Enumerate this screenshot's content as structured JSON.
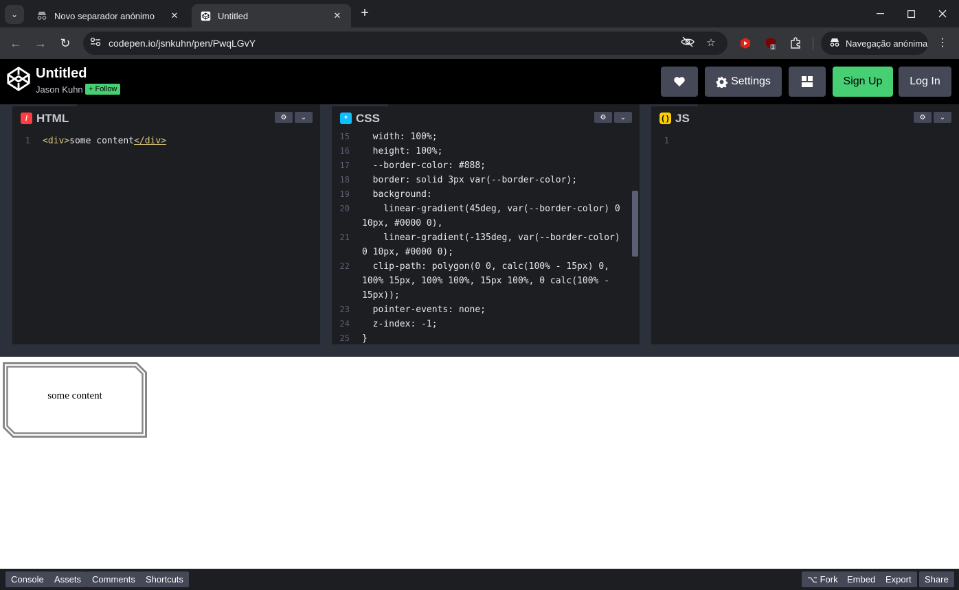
{
  "browser": {
    "tabs": [
      {
        "title": "Novo separador anónimo",
        "active": false
      },
      {
        "title": "Untitled",
        "active": true
      }
    ],
    "url": "codepen.io/jsnkuhn/pen/PwqLGvY",
    "incognito_label": "Navegação anónima",
    "ext_badge": "1"
  },
  "codepen": {
    "title": "Untitled",
    "author": "Jason Kuhn",
    "follow_label": "+ Follow",
    "settings_label": "Settings",
    "signup_label": "Sign Up",
    "login_label": "Log In"
  },
  "editors": {
    "html": {
      "label": "HTML",
      "lines": [
        {
          "n": "1",
          "text": "<div>some content</div>"
        }
      ]
    },
    "css": {
      "label": "CSS",
      "lines": [
        {
          "n": "15",
          "text": "  width: 100%;"
        },
        {
          "n": "16",
          "text": "  height: 100%;"
        },
        {
          "n": "17",
          "text": "  --border-color: #888;"
        },
        {
          "n": "18",
          "text": "  border: solid 3px var(--border-color);"
        },
        {
          "n": "19",
          "text": "  background:"
        },
        {
          "n": "20",
          "text": "    linear-gradient(45deg, var(--border-color) 0"
        },
        {
          "n": "",
          "text": "10px, #0000 0),"
        },
        {
          "n": "21",
          "text": "    linear-gradient(-135deg, var(--border-color)"
        },
        {
          "n": "",
          "text": "0 10px, #0000 0);"
        },
        {
          "n": "22",
          "text": "  clip-path: polygon(0 0, calc(100% - 15px) 0,"
        },
        {
          "n": "",
          "text": "100% 15px, 100% 100%, 15px 100%, 0 calc(100% -"
        },
        {
          "n": "",
          "text": "15px));"
        },
        {
          "n": "23",
          "text": "  pointer-events: none;"
        },
        {
          "n": "24",
          "text": "  z-index: -1;"
        },
        {
          "n": "25",
          "text": "}"
        }
      ]
    },
    "js": {
      "label": "JS",
      "lines": [
        {
          "n": "1",
          "text": ""
        }
      ]
    }
  },
  "preview": {
    "content": "some content"
  },
  "footer": {
    "left": [
      "Console",
      "Assets",
      "Comments",
      "Shortcuts"
    ],
    "right": [
      "⌥ Fork",
      "Embed",
      "Export",
      "Share"
    ]
  },
  "colors": {
    "accent_green": "#47cf73",
    "html_badge": "#ff3c41",
    "css_badge": "#0ebeff",
    "js_badge": "#fcd000",
    "box_border": "#888888"
  }
}
